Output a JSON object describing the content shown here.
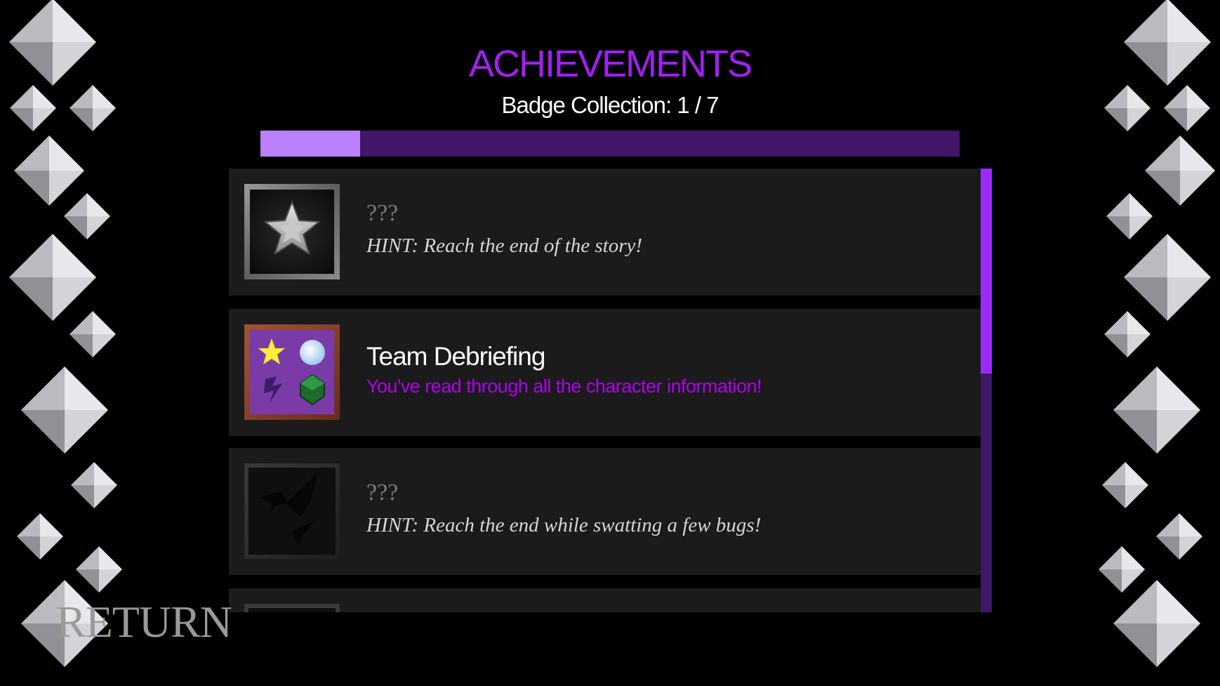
{
  "header": {
    "title": "ACHIEVEMENTS",
    "collection_text": "Badge Collection: 1 / 7"
  },
  "progress": {
    "unlocked": 1,
    "total": 7,
    "fraction": 0.143,
    "fill_color": "#bb80ff",
    "track_color": "#421568"
  },
  "achievements": [
    {
      "title": "???",
      "description": "HINT: Reach the end of the story!",
      "unlocked": false,
      "icon": "silver-star-icon"
    },
    {
      "title": "Team Debriefing",
      "description": "You've read through all the character information!",
      "unlocked": true,
      "icon": "team-emblems-icon"
    },
    {
      "title": "???",
      "description": "HINT: Reach the end while swatting a few bugs!",
      "unlocked": false,
      "icon": "broken-shards-icon"
    },
    {
      "title": "",
      "description": "",
      "unlocked": false,
      "icon": "locked-badge-icon"
    }
  ],
  "scroll": {
    "position_fraction": 0.0,
    "thumb_color": "#9a2cf7",
    "track_color": "#3d1768"
  },
  "footer": {
    "return_label": "RETURN"
  },
  "colors": {
    "accent": "#a020f0",
    "card_bg": "#1b1b1b",
    "background": "#000000"
  }
}
